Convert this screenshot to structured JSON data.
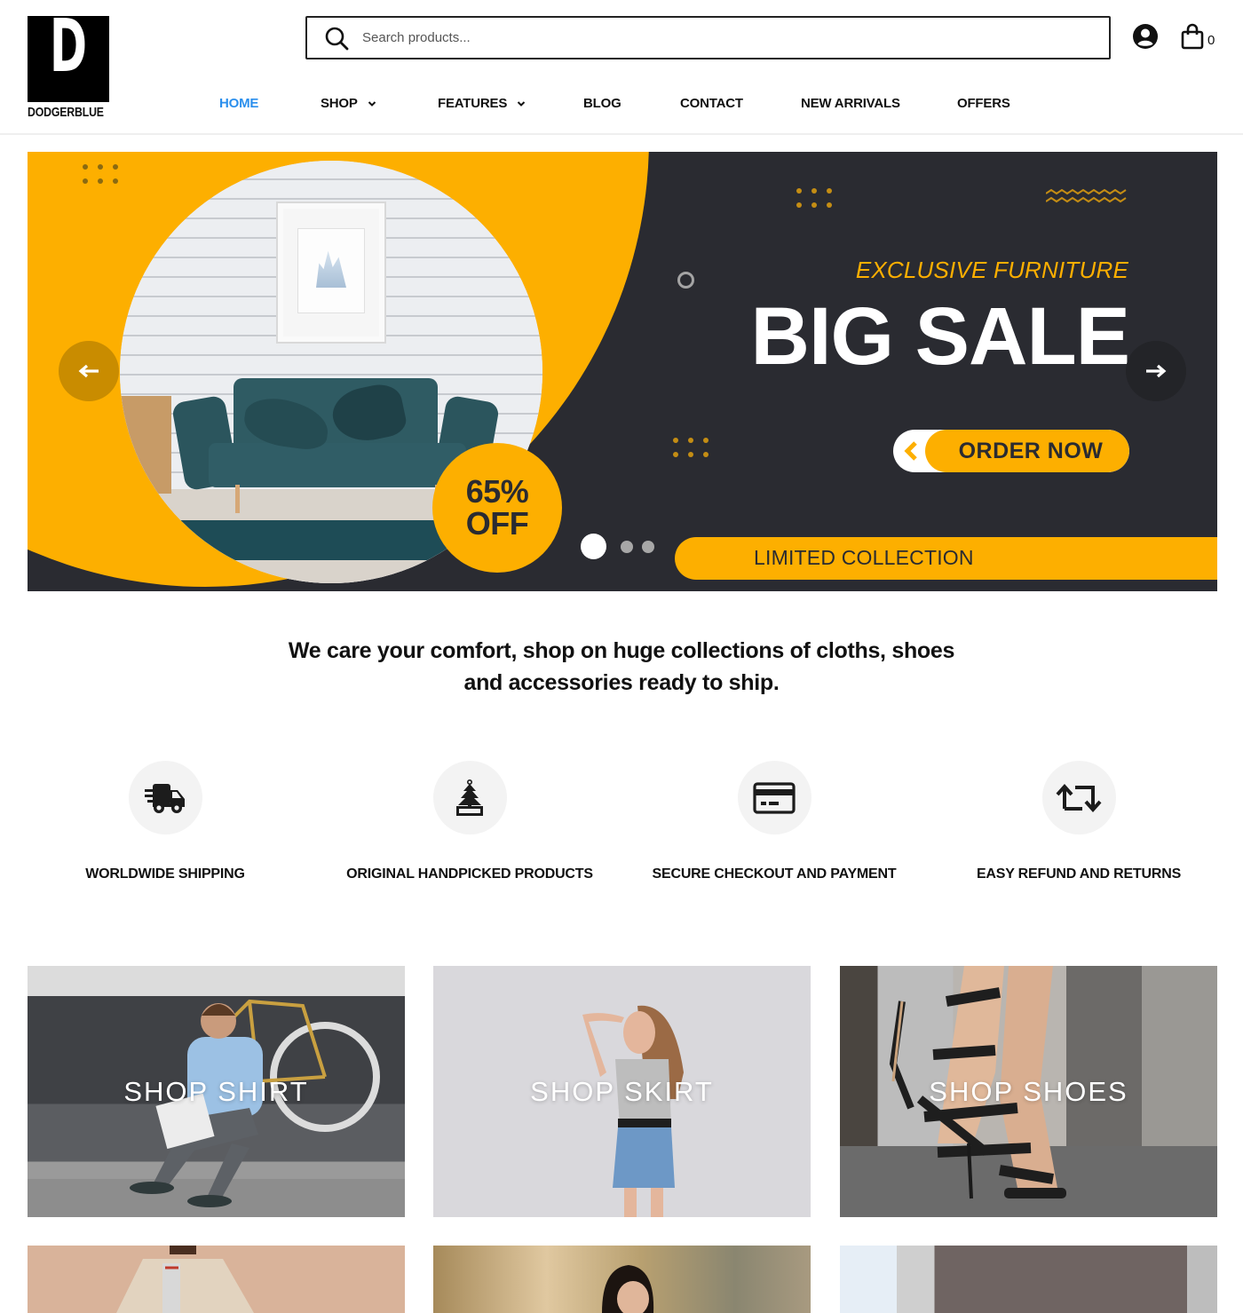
{
  "brand": {
    "logo_letter": "D",
    "name": "DODGERBLUE"
  },
  "search": {
    "placeholder": "Search products...",
    "value": ""
  },
  "header_icons": {
    "user": "user-circle-icon",
    "cart": "shopping-bag-icon",
    "cart_count": "0"
  },
  "nav": {
    "items": [
      {
        "label": "HOME",
        "active": true,
        "dropdown": false
      },
      {
        "label": "SHOP",
        "active": false,
        "dropdown": true
      },
      {
        "label": "FEATURES",
        "active": false,
        "dropdown": true
      },
      {
        "label": "BLOG",
        "active": false,
        "dropdown": false
      },
      {
        "label": "CONTACT",
        "active": false,
        "dropdown": false
      },
      {
        "label": "NEW ARRIVALS",
        "active": false,
        "dropdown": false
      },
      {
        "label": "OFFERS",
        "active": false,
        "dropdown": false
      }
    ]
  },
  "hero": {
    "subtitle": "EXCLUSIVE FURNITURE",
    "title": "BIG SALE",
    "cta_label": "ORDER NOW",
    "badge_line1": "65%",
    "badge_line2": "OFF",
    "ribbon": "LIMITED COLLECTION",
    "slides_total": 3,
    "active_slide": 1,
    "prev_icon": "arrow-left-icon",
    "next_icon": "arrow-right-icon"
  },
  "tagline": {
    "line1": "We care your comfort, shop on huge collections of cloths, shoes",
    "line2": "and accessories ready to ship."
  },
  "features": [
    {
      "icon": "shipping-truck-icon",
      "label": "WORLDWIDE SHIPPING"
    },
    {
      "icon": "tree-tag-icon",
      "label": "ORIGINAL HANDPICKED PRODUCTS"
    },
    {
      "icon": "credit-card-icon",
      "label": "SECURE CHECKOUT AND PAYMENT"
    },
    {
      "icon": "refund-arrows-icon",
      "label": "EASY REFUND AND RETURNS"
    }
  ],
  "categories": [
    {
      "label": "SHOP SHIRT"
    },
    {
      "label": "SHOP SKIRT"
    },
    {
      "label": "SHOP SHOES"
    }
  ],
  "colors": {
    "accent": "#2b8fed",
    "banner_yellow": "#fdaf00",
    "banner_dark": "#2a2b31"
  }
}
